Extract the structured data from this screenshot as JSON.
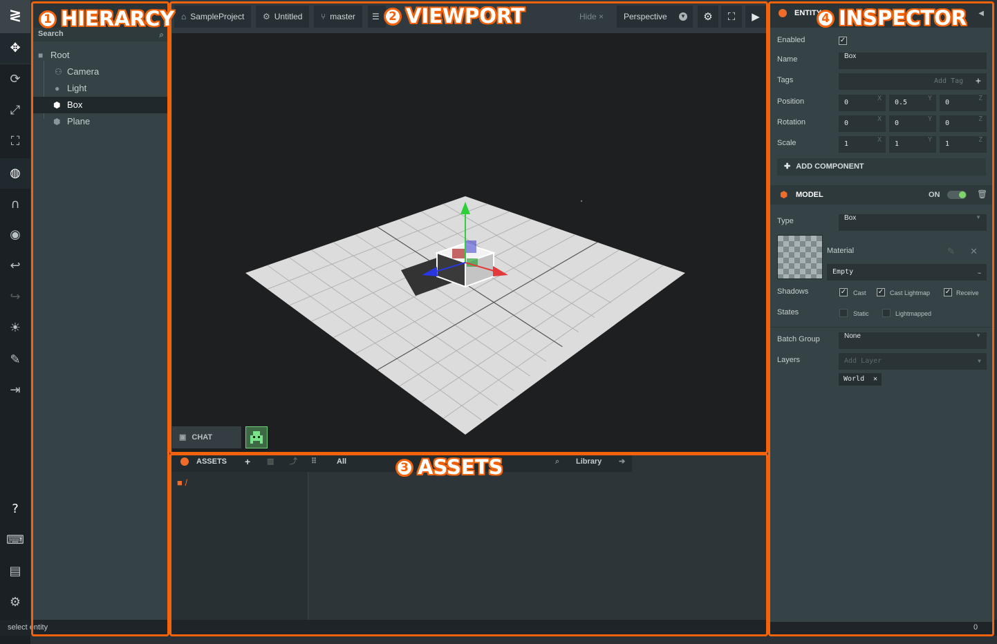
{
  "toolbar": {
    "logo": "≷",
    "tools": [
      {
        "name": "translate-icon",
        "glyph": "✥"
      },
      {
        "name": "rotate-icon",
        "glyph": "⟳"
      },
      {
        "name": "scale-icon",
        "glyph": "⤢"
      },
      {
        "name": "resize-icon",
        "glyph": "⛶"
      },
      {
        "name": "world-icon",
        "glyph": "◍"
      },
      {
        "name": "magnet-icon",
        "glyph": "∩"
      },
      {
        "name": "eye-icon",
        "glyph": "◉"
      },
      {
        "name": "undo-icon",
        "glyph": "↩"
      },
      {
        "name": "redo-icon",
        "glyph": "↪"
      },
      {
        "name": "light-icon",
        "glyph": "☀"
      },
      {
        "name": "edit-icon",
        "glyph": "✎"
      },
      {
        "name": "publish-icon",
        "glyph": "⇥"
      }
    ],
    "bottom": [
      {
        "name": "help-icon",
        "glyph": "?"
      },
      {
        "name": "keyboard-icon",
        "glyph": "⌨"
      },
      {
        "name": "comment-icon",
        "glyph": "▤"
      },
      {
        "name": "settings-icon",
        "glyph": "⚙"
      }
    ]
  },
  "hierarchy": {
    "search": "Search",
    "items": [
      {
        "label": "Root",
        "icon": "folder-icon"
      },
      {
        "label": "Camera",
        "icon": "camera-icon"
      },
      {
        "label": "Light",
        "icon": "light-icon"
      },
      {
        "label": "Box",
        "icon": "box-icon",
        "selected": true
      },
      {
        "label": "Plane",
        "icon": "plane-icon"
      }
    ]
  },
  "viewport": {
    "project": "SampleProject",
    "scene": "Untitled",
    "branch": "master",
    "hide": "Hide ×",
    "camera": "Perspective"
  },
  "chat": {
    "label": "CHAT"
  },
  "assets": {
    "title": "ASSETS",
    "filter": "All",
    "library": "Library",
    "path": "/"
  },
  "status": {
    "left": "select entity",
    "right": "0"
  },
  "inspector": {
    "title": "ENTITY",
    "labels": {
      "enabled": "Enabled",
      "name": "Name",
      "tags": "Tags",
      "position": "Position",
      "rotation": "Rotation",
      "scale": "Scale"
    },
    "name_value": "Box",
    "tag_placeholder": "Add Tag",
    "position": [
      "0",
      "0.5",
      "0"
    ],
    "rotation": [
      "0",
      "0",
      "0"
    ],
    "scale": [
      "1",
      "1",
      "1"
    ],
    "axes": [
      "X",
      "Y",
      "Z"
    ],
    "add_component": "ADD COMPONENT",
    "model": {
      "title": "MODEL",
      "state": "ON",
      "type_label": "Type",
      "type_value": "Box",
      "material_label": "Material",
      "material_value": "Empty",
      "shadows_label": "Shadows",
      "cast": "Cast",
      "cast_lightmap": "Cast Lightmap",
      "receive": "Receive",
      "states_label": "States",
      "static": "Static",
      "lightmapped": "Lightmapped",
      "batch_label": "Batch Group",
      "batch_value": "None",
      "layers_label": "Layers",
      "layers_placeholder": "Add Layer",
      "layer_tag": "World"
    }
  },
  "annotations": {
    "hierarchy": {
      "num": "1",
      "label": "HIERARCY"
    },
    "viewport": {
      "num": "2",
      "label": "VIEWPORT"
    },
    "assets": {
      "num": "3",
      "label": "ASSETS"
    },
    "inspector": {
      "num": "4",
      "label": "INSPECTOR"
    }
  },
  "colors": {
    "accent": "#f2630b",
    "brand": "#f06c2a",
    "selection": "#1f282b"
  }
}
